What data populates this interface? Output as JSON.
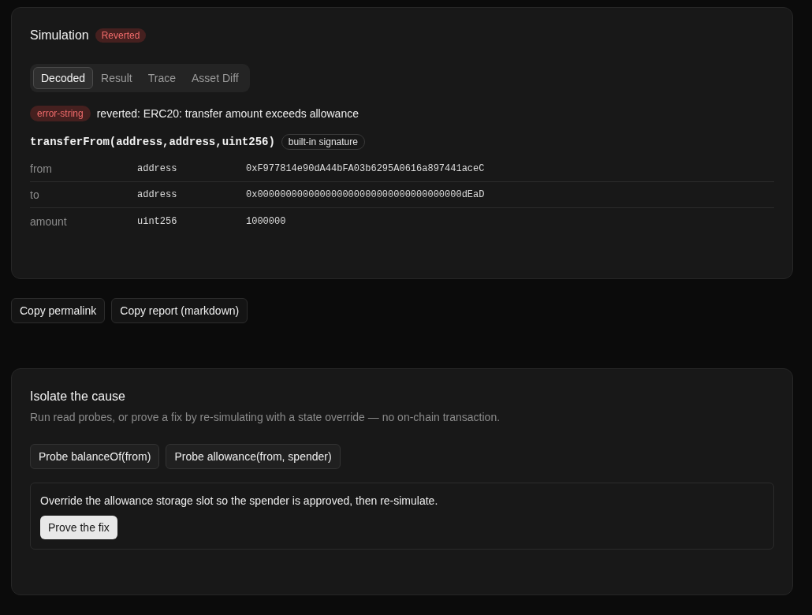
{
  "simulation": {
    "title": "Simulation",
    "status": "Reverted",
    "tabs": [
      {
        "label": "Decoded",
        "selected": true
      },
      {
        "label": "Result",
        "selected": false
      },
      {
        "label": "Trace",
        "selected": false
      },
      {
        "label": "Asset Diff",
        "selected": false
      }
    ],
    "error": {
      "tag": "error-string",
      "message": "reverted: ERC20: transfer amount exceeds allowance"
    },
    "signature": {
      "text": "transferFrom(address,address,uint256)",
      "badge": "built-in signature"
    },
    "params": [
      {
        "name": "from",
        "type": "address",
        "value": "0xF977814e90dA44bFA03b6295A0616a897441aceC"
      },
      {
        "name": "to",
        "type": "address",
        "value": "0x000000000000000000000000000000000000dEaD"
      },
      {
        "name": "amount",
        "type": "uint256",
        "value": "1000000"
      }
    ]
  },
  "actions": [
    "Copy permalink",
    "Copy report (markdown)"
  ],
  "isolate": {
    "title": "Isolate the cause",
    "description": "Run read probes, or prove a fix by re-simulating with a state override — no on-chain transaction.",
    "probes": [
      "Probe balanceOf(from)",
      "Probe allowance(from, spender)"
    ],
    "fix": {
      "text": "Override the allowance storage slot so the spender is approved, then re-simulate.",
      "button": "Prove the fix"
    }
  }
}
